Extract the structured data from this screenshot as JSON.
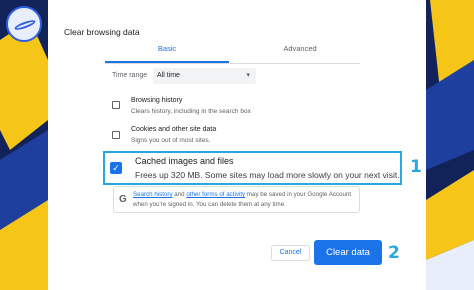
{
  "dialog": {
    "title": "Clear browsing data",
    "tabs": [
      {
        "label": "Basic",
        "active": true
      },
      {
        "label": "Advanced",
        "active": false
      }
    ],
    "time_range": {
      "label": "Time range",
      "selected": "All time"
    },
    "options": [
      {
        "title": "Browsing history",
        "subtitle": "Clears history, including in the search box",
        "checked": false
      },
      {
        "title": "Cookies and other site data",
        "subtitle": "Signs you out of most sites.",
        "checked": false
      },
      {
        "title": "Cached images and files",
        "subtitle": "Frees up 320 MB. Some sites may load more slowly on your next visit.",
        "checked": true
      }
    ],
    "info": {
      "link1": "Search history",
      "and": " and ",
      "link2": "other forms of activity",
      "rest": " may be saved in your Google Account when you're signed in. You can delete them at any time."
    },
    "cancel_label": "Cancel",
    "clear_label": "Clear data"
  },
  "annotations": {
    "step1": "1",
    "step2": "2"
  },
  "colors": {
    "accent": "#1a73e8",
    "highlight": "#29a8e0",
    "background": "#0d1b3e"
  }
}
